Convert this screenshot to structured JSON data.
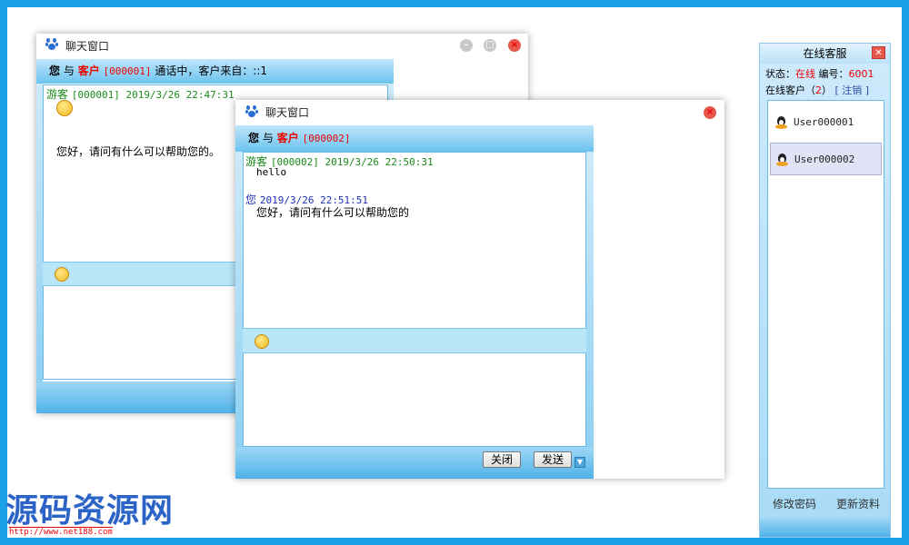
{
  "window1": {
    "title": "聊天窗口",
    "header": {
      "you": "您",
      "with": "与",
      "role": "客户",
      "id": "[000001]",
      "status": "通话中，客户来自：::1"
    },
    "message": {
      "sender": "游客",
      "meta": "[000001] 2019/3/26 22:47:31"
    },
    "reply": "您好，请问有什么可以帮助您的。",
    "controls": {
      "minimize": "–",
      "maximize": "□",
      "close": "×"
    }
  },
  "window2": {
    "title": "聊天窗口",
    "header": {
      "you": "您",
      "with": "与",
      "role": "客户",
      "id": "[000002]"
    },
    "messages": [
      {
        "sender": "游客",
        "meta": "[000002] 2019/3/26 22:50:31",
        "text": "hello"
      },
      {
        "sender": "您",
        "meta": "2019/3/26 22:51:51",
        "text": "您好，请问有什么可以帮助您的"
      }
    ],
    "close_button": "关闭",
    "send_button": "发送",
    "controls": {
      "close": "×"
    }
  },
  "panel": {
    "title": "在线客服",
    "status_label": "状态：",
    "status_value": "在线",
    "number_label": "编号：",
    "number_value": "6001",
    "online_label": "在线客户（",
    "online_count": "2",
    "online_suffix": "）",
    "logout": "[ 注销 ]",
    "users": [
      "User000001",
      "User000002"
    ],
    "change_password": "修改密码",
    "update_profile": "更新资料"
  },
  "watermark": {
    "text": "源码资源网",
    "url": "http://www.net188.com"
  },
  "colors": {
    "frame": "#1ba1e6",
    "accent_red": "#e00000",
    "panel_bg": "#cfeafc"
  }
}
